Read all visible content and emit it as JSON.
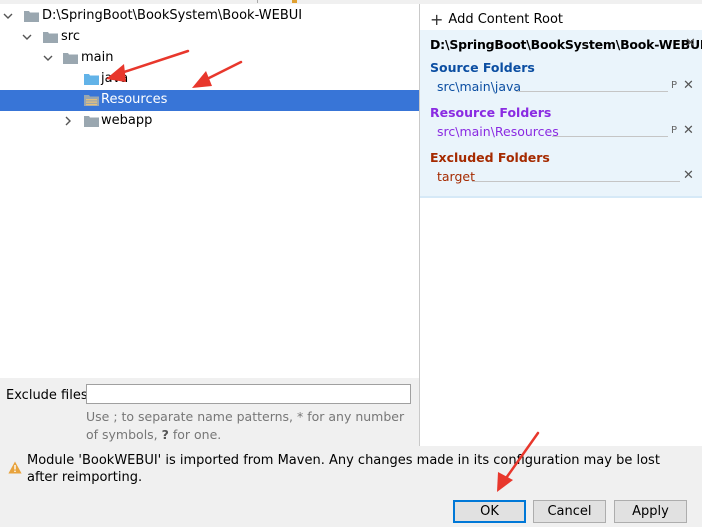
{
  "tree": {
    "root_label": "D:\\SpringBoot\\BookSystem\\Book-WEBUI",
    "src_label": "src",
    "main_label": "main",
    "java_label": "java",
    "resources_label": "Resources",
    "webapp_label": "webapp"
  },
  "content_root": {
    "add_label": "Add Content Root",
    "path": "D:\\SpringBoot\\BookSystem\\Book-WEBUI",
    "source_title": "Source Folders",
    "source_item": "src\\main\\java",
    "resource_title": "Resource Folders",
    "resource_item": "src\\main\\Resources",
    "excluded_title": "Excluded Folders",
    "excluded_item": "target",
    "props_glyph": "P"
  },
  "exclude": {
    "label": "Exclude files:",
    "value": "",
    "hint_part1": "Use ; to separate name patterns, * for any number of symbols, ",
    "hint_q": "?",
    "hint_part2": " for one."
  },
  "warning": {
    "text": "Module 'BookWEBUI' is imported from Maven. Any changes made in its configuration may be lost after reimporting."
  },
  "buttons": {
    "ok": "OK",
    "cancel": "Cancel",
    "apply": "Apply"
  },
  "colors": {
    "selection": "#3875d7",
    "source": "#0b4ea2",
    "resource": "#8a2be2",
    "excluded": "#a52a00",
    "annotation": "#e8372c"
  },
  "icons": [
    "chevron-down-icon",
    "chevron-right-icon",
    "folder-icon",
    "source-folder-icon",
    "resource-folder-icon",
    "close-icon",
    "properties-icon",
    "warning-icon",
    "plus-icon"
  ]
}
